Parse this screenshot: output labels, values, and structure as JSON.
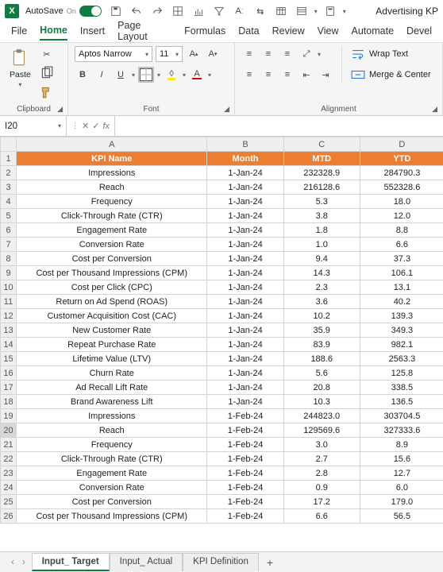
{
  "titlebar": {
    "autosave_label": "AutoSave",
    "autosave_state": "On",
    "doc_title": "Advertising KP"
  },
  "menutabs": [
    "File",
    "Home",
    "Insert",
    "Page Layout",
    "Formulas",
    "Data",
    "Review",
    "View",
    "Automate",
    "Devel"
  ],
  "menutabs_active": "Home",
  "ribbon": {
    "clipboard": {
      "paste": "Paste",
      "label": "Clipboard"
    },
    "font": {
      "name": "Aptos Narrow",
      "size": "11",
      "label": "Font"
    },
    "alignment": {
      "wrap": "Wrap Text",
      "merge": "Merge & Center",
      "label": "Alignment"
    }
  },
  "namebox": "I20",
  "fx_symbol": "fx",
  "columns": [
    "A",
    "B",
    "C",
    "D"
  ],
  "header_row": [
    "KPI Name",
    "Month",
    "MTD",
    "YTD"
  ],
  "rows": [
    {
      "n": 2,
      "kpi": "Impressions",
      "month": "1-Jan-24",
      "mtd": "232328.9",
      "ytd": "284790.3"
    },
    {
      "n": 3,
      "kpi": "Reach",
      "month": "1-Jan-24",
      "mtd": "216128.6",
      "ytd": "552328.6"
    },
    {
      "n": 4,
      "kpi": "Frequency",
      "month": "1-Jan-24",
      "mtd": "5.3",
      "ytd": "18.0"
    },
    {
      "n": 5,
      "kpi": "Click-Through Rate (CTR)",
      "month": "1-Jan-24",
      "mtd": "3.8",
      "ytd": "12.0"
    },
    {
      "n": 6,
      "kpi": "Engagement Rate",
      "month": "1-Jan-24",
      "mtd": "1.8",
      "ytd": "8.8"
    },
    {
      "n": 7,
      "kpi": "Conversion Rate",
      "month": "1-Jan-24",
      "mtd": "1.0",
      "ytd": "6.6"
    },
    {
      "n": 8,
      "kpi": "Cost per Conversion",
      "month": "1-Jan-24",
      "mtd": "9.4",
      "ytd": "37.3"
    },
    {
      "n": 9,
      "kpi": "Cost per Thousand Impressions (CPM)",
      "month": "1-Jan-24",
      "mtd": "14.3",
      "ytd": "106.1"
    },
    {
      "n": 10,
      "kpi": "Cost per Click (CPC)",
      "month": "1-Jan-24",
      "mtd": "2.3",
      "ytd": "13.1"
    },
    {
      "n": 11,
      "kpi": "Return on Ad Spend (ROAS)",
      "month": "1-Jan-24",
      "mtd": "3.6",
      "ytd": "40.2"
    },
    {
      "n": 12,
      "kpi": "Customer Acquisition Cost (CAC)",
      "month": "1-Jan-24",
      "mtd": "10.2",
      "ytd": "139.3"
    },
    {
      "n": 13,
      "kpi": "New Customer Rate",
      "month": "1-Jan-24",
      "mtd": "35.9",
      "ytd": "349.3"
    },
    {
      "n": 14,
      "kpi": "Repeat Purchase Rate",
      "month": "1-Jan-24",
      "mtd": "83.9",
      "ytd": "982.1"
    },
    {
      "n": 15,
      "kpi": "Lifetime Value (LTV)",
      "month": "1-Jan-24",
      "mtd": "188.6",
      "ytd": "2563.3"
    },
    {
      "n": 16,
      "kpi": "Churn Rate",
      "month": "1-Jan-24",
      "mtd": "5.6",
      "ytd": "125.8"
    },
    {
      "n": 17,
      "kpi": "Ad Recall Lift Rate",
      "month": "1-Jan-24",
      "mtd": "20.8",
      "ytd": "338.5"
    },
    {
      "n": 18,
      "kpi": "Brand Awareness Lift",
      "month": "1-Jan-24",
      "mtd": "10.3",
      "ytd": "136.5"
    },
    {
      "n": 19,
      "kpi": "Impressions",
      "month": "1-Feb-24",
      "mtd": "244823.0",
      "ytd": "303704.5"
    },
    {
      "n": 20,
      "kpi": "Reach",
      "month": "1-Feb-24",
      "mtd": "129569.6",
      "ytd": "327333.6"
    },
    {
      "n": 21,
      "kpi": "Frequency",
      "month": "1-Feb-24",
      "mtd": "3.0",
      "ytd": "8.9"
    },
    {
      "n": 22,
      "kpi": "Click-Through Rate (CTR)",
      "month": "1-Feb-24",
      "mtd": "2.7",
      "ytd": "15.6"
    },
    {
      "n": 23,
      "kpi": "Engagement Rate",
      "month": "1-Feb-24",
      "mtd": "2.8",
      "ytd": "12.7"
    },
    {
      "n": 24,
      "kpi": "Conversion Rate",
      "month": "1-Feb-24",
      "mtd": "0.9",
      "ytd": "6.0"
    },
    {
      "n": 25,
      "kpi": "Cost per Conversion",
      "month": "1-Feb-24",
      "mtd": "17.2",
      "ytd": "179.0"
    },
    {
      "n": 26,
      "kpi": "Cost per Thousand Impressions (CPM)",
      "month": "1-Feb-24",
      "mtd": "6.6",
      "ytd": "56.5"
    }
  ],
  "sheet_tabs": [
    "Input_ Target",
    "Input_ Actual",
    "KPI Definition"
  ],
  "sheet_tabs_active": "Input_ Target"
}
